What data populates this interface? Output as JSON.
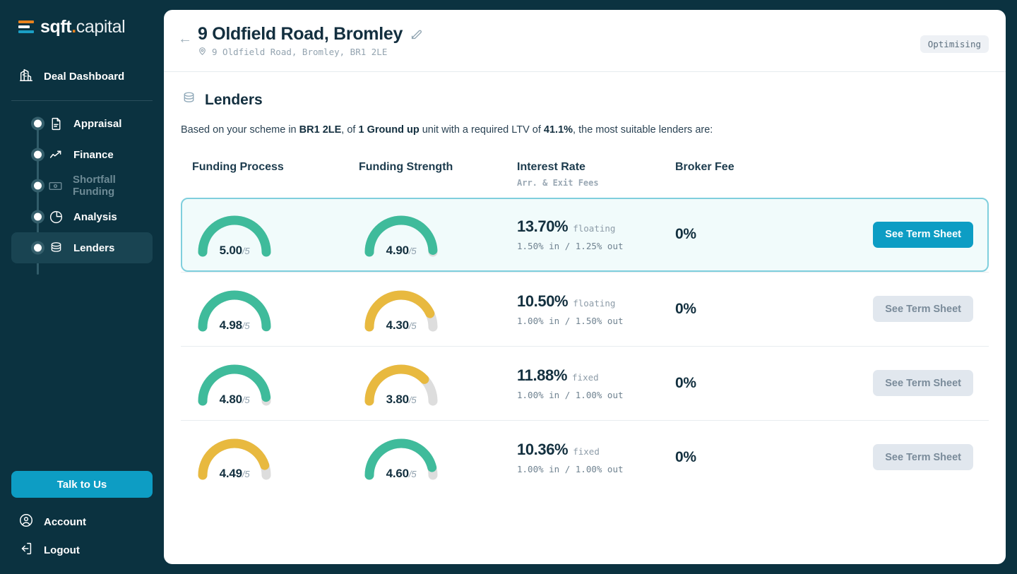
{
  "brand": {
    "name_bold": "sqft",
    "name_dot": ".",
    "name_thin": "capital"
  },
  "sidebar": {
    "dashboard": {
      "label": "Deal Dashboard",
      "icon": "buildings-icon"
    },
    "steps": [
      {
        "label": "Appraisal",
        "icon": "document-icon",
        "state": "enabled"
      },
      {
        "label": "Finance",
        "icon": "trend-up-icon",
        "state": "enabled"
      },
      {
        "label": "Shortfall Funding",
        "icon": "banknote-icon",
        "state": "disabled"
      },
      {
        "label": "Analysis",
        "icon": "pie-chart-icon",
        "state": "enabled"
      },
      {
        "label": "Lenders",
        "icon": "coins-stack-icon",
        "state": "active"
      }
    ],
    "talk_to_us": "Talk to Us",
    "account": {
      "label": "Account",
      "icon": "user-circle-icon"
    },
    "logout": {
      "label": "Logout",
      "icon": "logout-icon"
    }
  },
  "header": {
    "back_icon": "arrow-left-icon",
    "title": "9 Oldfield Road, Bromley",
    "edit_icon": "pencil-edit-icon",
    "pin_icon": "map-pin-icon",
    "address": "9 Oldfield Road, Bromley, BR1 2LE",
    "status": "Optimising"
  },
  "section": {
    "icon": "coins-stack-icon",
    "title": "Lenders",
    "desc_1": "Based on your scheme in ",
    "desc_b1": "BR1 2LE",
    "desc_2": ", of ",
    "desc_b2": "1 Ground up",
    "desc_3": " unit with a required LTV of ",
    "desc_b3": "41.1%",
    "desc_4": ", the most suitable lenders are:"
  },
  "table": {
    "headers": {
      "funding_process": "Funding Process",
      "funding_strength": "Funding Strength",
      "interest_rate": "Interest Rate",
      "interest_rate_sub": "Arr. & Exit Fees",
      "broker_fee": "Broker Fee"
    },
    "button_label": "See Term Sheet",
    "denominator": "/5"
  },
  "colors": {
    "green": "#3fbb9b",
    "amber": "#e8b93f",
    "track": "#dddddd",
    "accent": "#0d9dc4",
    "highlight_border": "#7fcfdd",
    "highlight_bg": "#f1fbfb",
    "sidebar": "#0b3240"
  },
  "chart_data": {
    "type": "gauge",
    "max": 5,
    "title": "Lender funding process & strength gauges",
    "series": [
      {
        "name": "Funding Process",
        "values": [
          5.0,
          4.98,
          4.8,
          4.49
        ]
      },
      {
        "name": "Funding Strength",
        "values": [
          4.9,
          4.3,
          3.8,
          4.6
        ]
      }
    ]
  },
  "rows": [
    {
      "featured": true,
      "process": {
        "value": "5.00",
        "num": 5.0,
        "color": "green"
      },
      "strength": {
        "value": "4.90",
        "num": 4.9,
        "color": "green"
      },
      "rate": "13.70%",
      "rate_type": "floating",
      "fees": "1.50% in / 1.25% out",
      "broker_fee": "0%",
      "button": "See Term Sheet",
      "button_state": "primary"
    },
    {
      "featured": false,
      "process": {
        "value": "4.98",
        "num": 4.98,
        "color": "green"
      },
      "strength": {
        "value": "4.30",
        "num": 4.3,
        "color": "amber"
      },
      "rate": "10.50%",
      "rate_type": "floating",
      "fees": "1.00% in / 1.50% out",
      "broker_fee": "0%",
      "button": "See Term Sheet",
      "button_state": "muted"
    },
    {
      "featured": false,
      "process": {
        "value": "4.80",
        "num": 4.8,
        "color": "green"
      },
      "strength": {
        "value": "3.80",
        "num": 3.8,
        "color": "amber"
      },
      "rate": "11.88%",
      "rate_type": "fixed",
      "fees": "1.00% in / 1.00% out",
      "broker_fee": "0%",
      "button": "See Term Sheet",
      "button_state": "muted"
    },
    {
      "featured": false,
      "process": {
        "value": "4.49",
        "num": 4.49,
        "color": "amber"
      },
      "strength": {
        "value": "4.60",
        "num": 4.6,
        "color": "green"
      },
      "rate": "10.36%",
      "rate_type": "fixed",
      "fees": "1.00% in / 1.00% out",
      "broker_fee": "0%",
      "button": "See Term Sheet",
      "button_state": "muted"
    }
  ]
}
